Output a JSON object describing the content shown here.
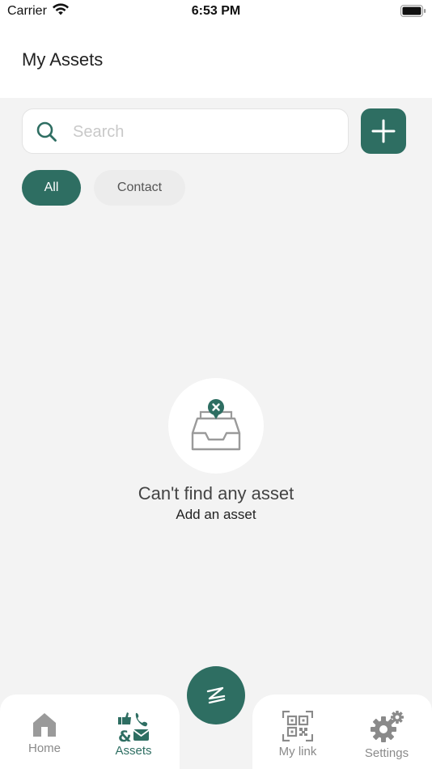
{
  "status_bar": {
    "carrier": "Carrier",
    "time": "6:53 PM"
  },
  "header": {
    "title": "My Assets"
  },
  "search": {
    "placeholder": "Search",
    "value": ""
  },
  "filters": {
    "chips": [
      {
        "label": "All",
        "selected": true
      },
      {
        "label": "Contact",
        "selected": false
      }
    ]
  },
  "empty_state": {
    "title": "Can't find any asset",
    "subtitle": "Add an asset",
    "icon": "empty-inbox-icon"
  },
  "tab_bar": {
    "items": [
      {
        "label": "Home",
        "icon": "home-icon",
        "active": false
      },
      {
        "label": "Assets",
        "icon": "assets-icon",
        "active": true
      },
      {
        "label": "My link",
        "icon": "qr-code-icon",
        "active": false
      },
      {
        "label": "Settings",
        "icon": "gear-icon",
        "active": false
      }
    ],
    "center_button_icon": "app-logo-icon"
  },
  "colors": {
    "accent": "#2e6e62",
    "background": "#f3f3f3",
    "inactive_tab": "#8a8a8a"
  }
}
